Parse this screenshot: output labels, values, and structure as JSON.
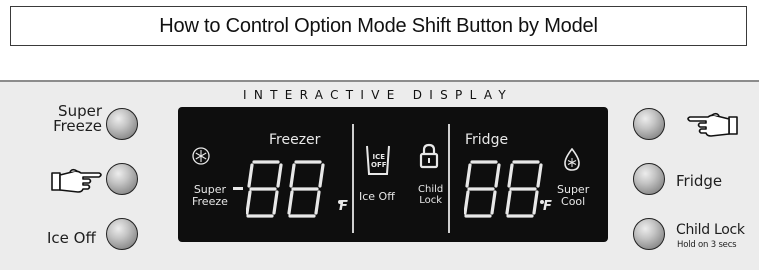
{
  "title": "How to Control Option Mode Shift Button by Model",
  "panel": {
    "header": "INTERACTIVE DISPLAY",
    "left_buttons": {
      "super_freeze_line1": "Super",
      "super_freeze_line2": "Freeze",
      "ice_off": "Ice Off"
    },
    "right_buttons": {
      "fridge": "Fridge",
      "child_lock": "Child Lock",
      "child_lock_hint": "Hold on 3 secs"
    },
    "display": {
      "freezer_title": "Freezer",
      "fridge_title": "Fridge",
      "super_freeze_line1": "Super",
      "super_freeze_line2": "Freeze",
      "super_cool_line1": "Super",
      "super_cool_line2": "Cool",
      "ice_off": "Ice Off",
      "ice_off_icon_line1": "ICE",
      "ice_off_icon_line2": "OFF",
      "child_lock_line1": "Child",
      "child_lock_line2": "Lock",
      "freezer_digits": "88",
      "fridge_digits": "88",
      "freezer_unit": "F",
      "fridge_unit": "F",
      "minus_sign": "-"
    }
  },
  "colors": {
    "display_bg": "#0e0e0e",
    "display_text": "#e8e8e8",
    "panel_bg": "#ececec",
    "button_gray": "#a8a8a8"
  },
  "icons": [
    "snowflake-icon",
    "ice-bucket-icon",
    "lock-icon",
    "droplet-icon",
    "pointing-hand-icon"
  ]
}
